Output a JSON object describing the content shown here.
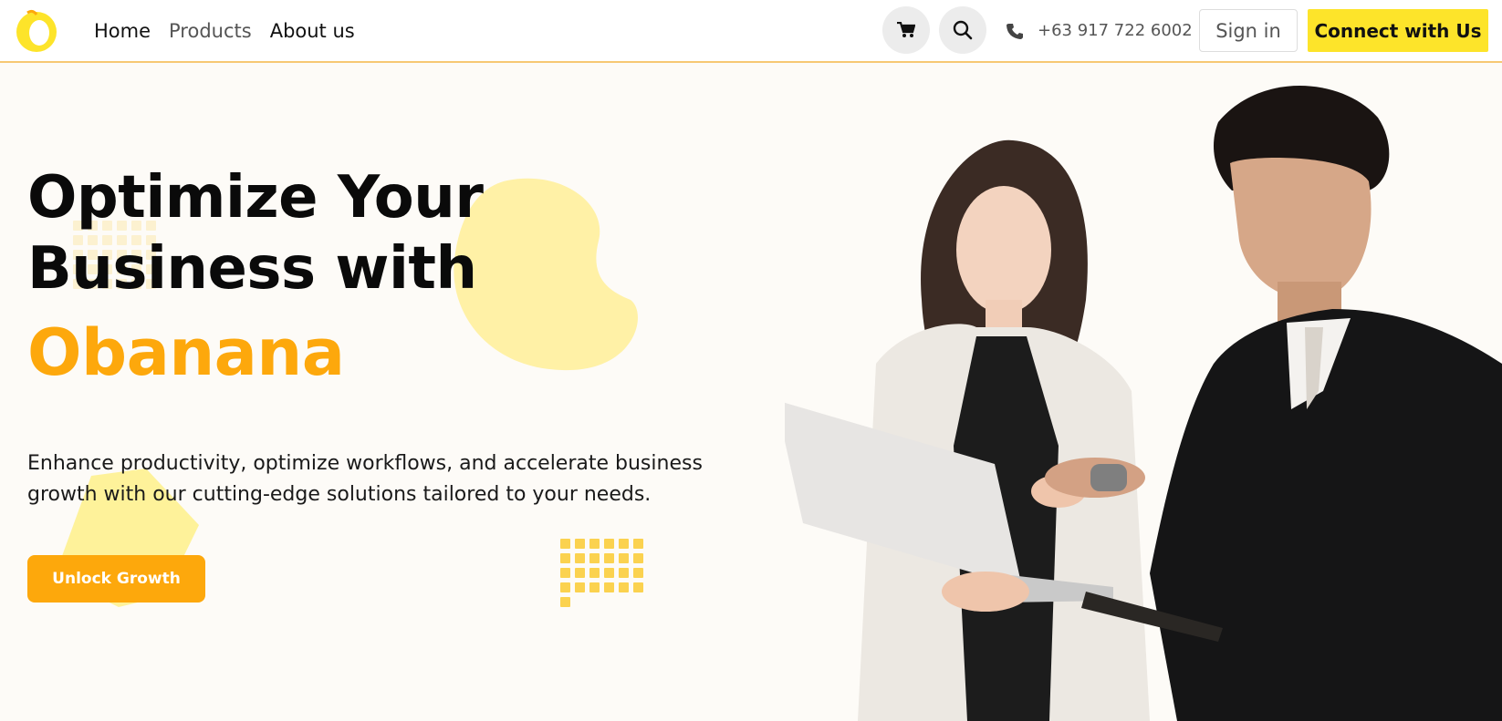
{
  "nav": {
    "links": [
      "Home",
      "Products",
      "About us"
    ],
    "phone": "+63 917 722 6002",
    "signin_label": "Sign in",
    "connect_label": "Connect with Us"
  },
  "hero": {
    "headline_line1": "Optimize Your",
    "headline_line2": "Business with",
    "brand": "Obanana",
    "description": "Enhance productivity, optimize workflows, and accelerate business growth with our cutting-edge solutions tailored to your needs.",
    "cta_label": "Unlock Growth"
  },
  "colors": {
    "accent_orange": "#fda80c",
    "accent_yellow": "#fde42a",
    "blob_yellow": "#fff1a6"
  },
  "icons": [
    "obanana-logo",
    "cart-icon",
    "search-icon",
    "phone-icon"
  ]
}
